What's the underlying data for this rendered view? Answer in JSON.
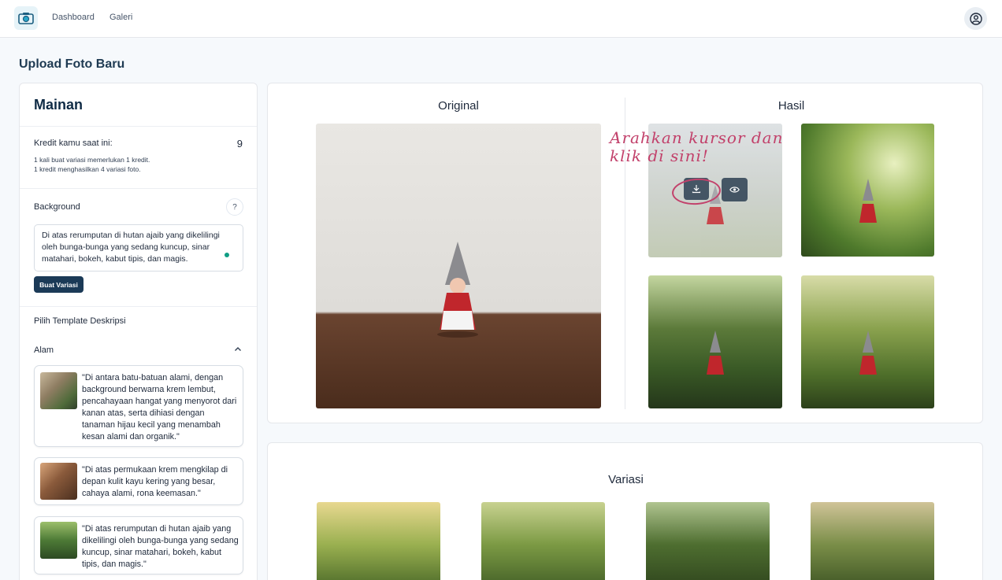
{
  "nav": {
    "logo_icon": "camera-icon",
    "links": [
      "Dashboard",
      "Galeri"
    ],
    "profile_icon": "user-circle-icon"
  },
  "page_title": "Upload Foto Baru",
  "left": {
    "title": "Mainan",
    "credit_label": "Kredit kamu saat ini:",
    "credit_value": "9",
    "credit_note_1": "1 kali buat variasi memerlukan 1 kredit.",
    "credit_note_2": "1 kredit menghasilkan 4 variasi foto.",
    "background_label": "Background",
    "help_label": "?",
    "background_text": "Di atas rerumputan di hutan ajaib yang dikelilingi oleh bunga-bunga yang sedang kuncup, sinar matahari, bokeh, kabut tipis, dan magis.",
    "create_button": "Buat Variasi",
    "template_label": "Pilih Template Deskripsi",
    "category_label": "Alam",
    "templates": [
      "\"Di antara batu-batuan alami, dengan background berwarna krem lembut, pencahayaan hangat yang menyorot dari kanan atas, serta dihiasi dengan tanaman hijau kecil yang menambah kesan alami dan organik.\"",
      "\"Di atas permukaan krem mengkilap di depan kulit kayu kering yang besar, cahaya alami, rona keemasan.\"",
      "\"Di atas rerumputan di hutan ajaib yang dikelilingi oleh bunga-bunga yang sedang kuncup, sinar matahari, bokeh, kabut tipis, dan magis.\""
    ]
  },
  "result": {
    "original_title": "Original",
    "hasil_title": "Hasil",
    "hint_line_1": "Arahkan kursor dan",
    "hint_line_2": "klik di sini!",
    "download_icon": "download-icon",
    "preview_icon": "eye-icon"
  },
  "variasi": {
    "title": "Variasi"
  },
  "colors": {
    "primary": "#1b3a57",
    "accent_hint": "#c2416b",
    "background": "#f6f9fc"
  }
}
